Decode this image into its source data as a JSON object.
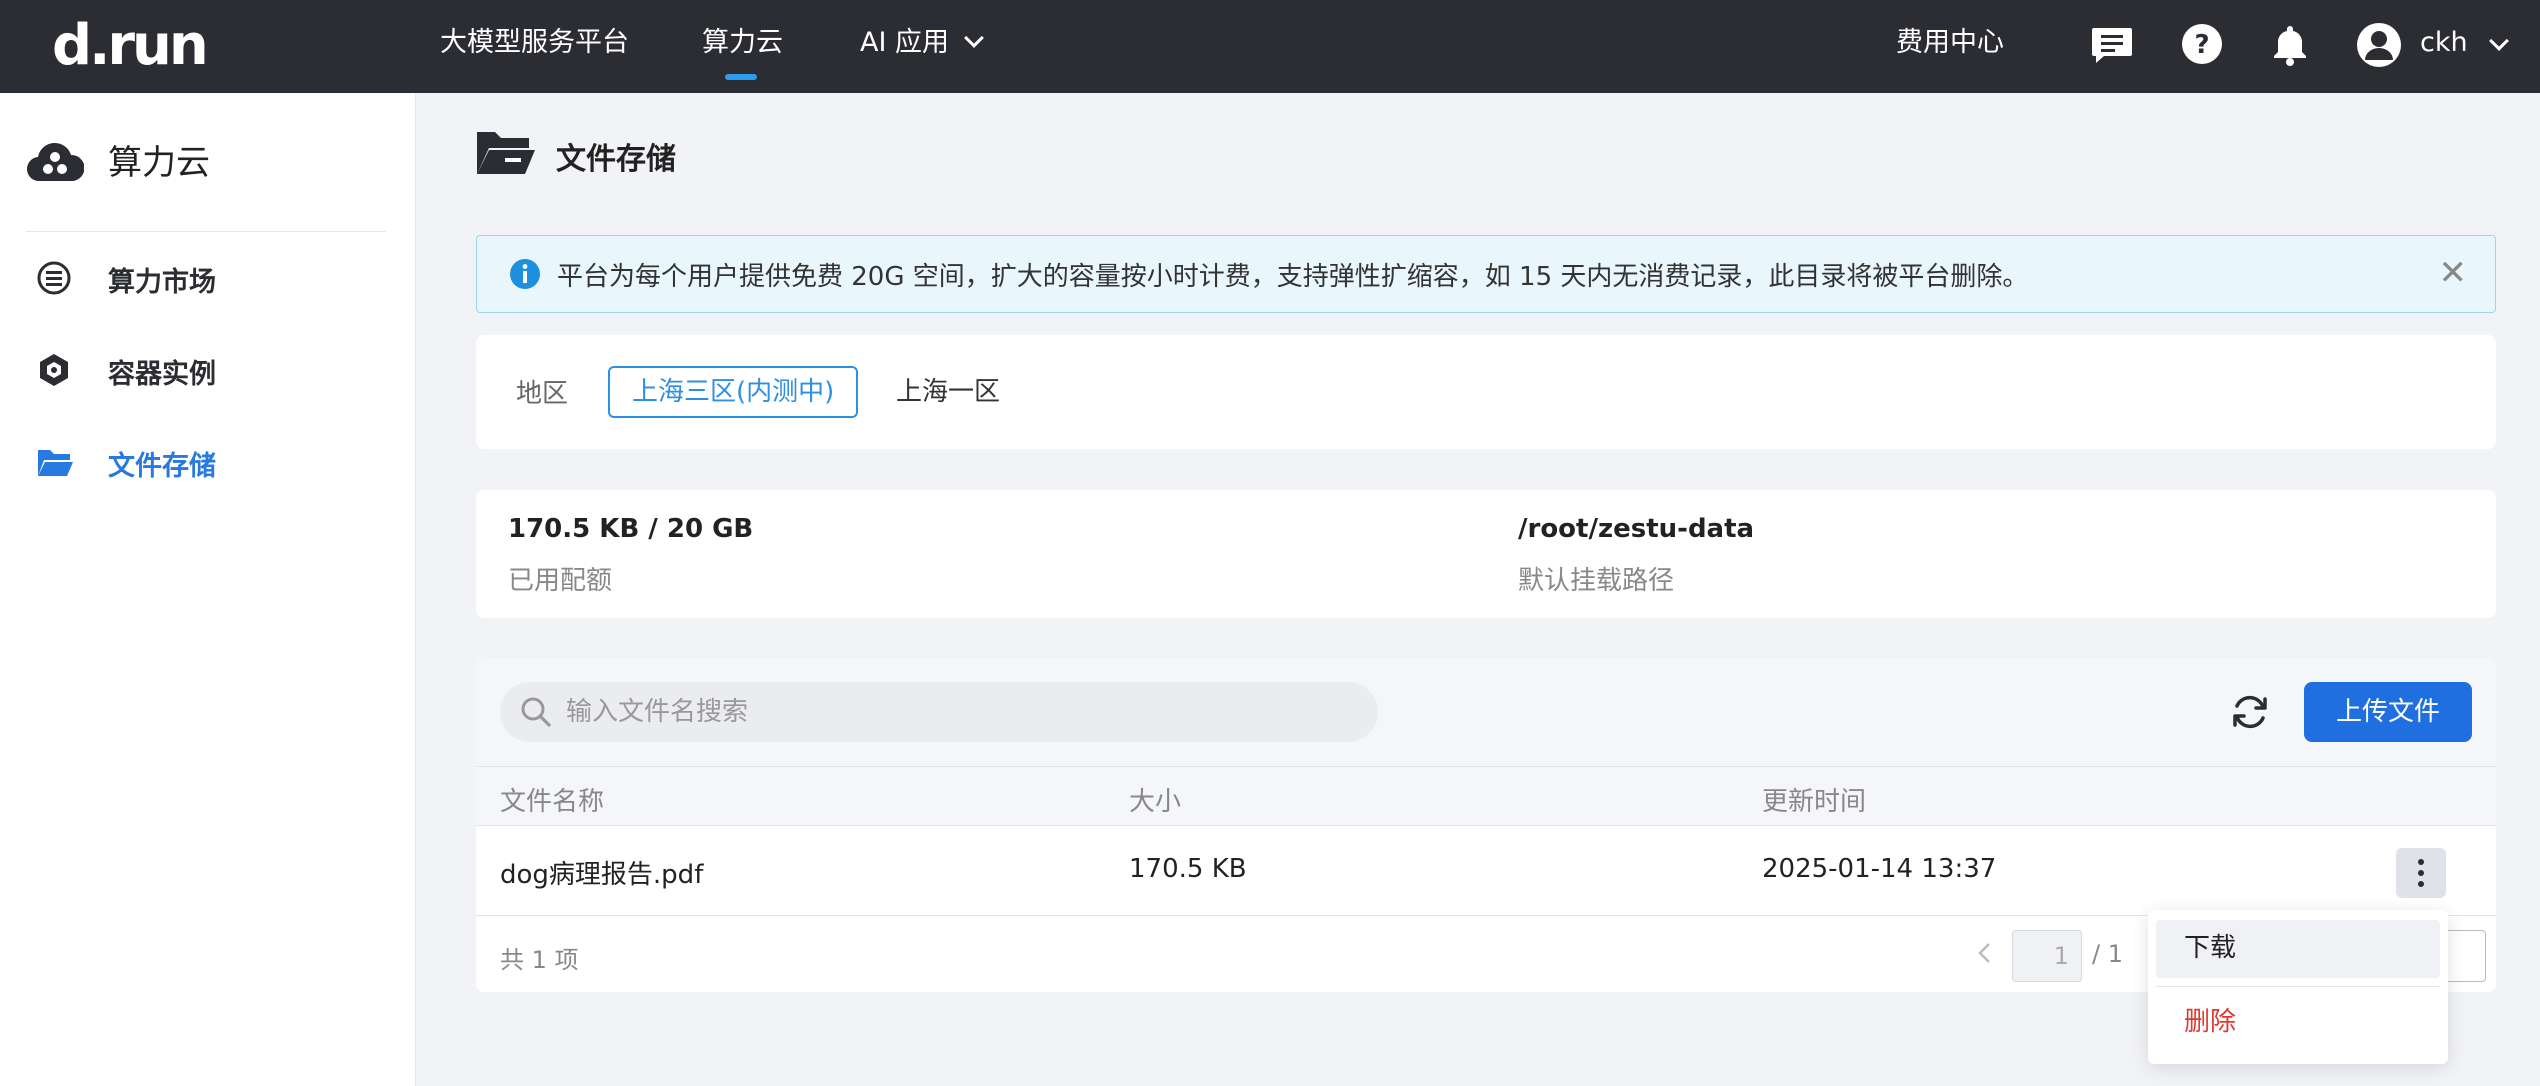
{
  "app": {
    "logo": "d.run"
  },
  "topnav": {
    "items": [
      {
        "label": "大模型服务平台"
      },
      {
        "label": "算力云"
      },
      {
        "label": "AI 应用"
      }
    ],
    "billing": "费用中心",
    "user": "ckh"
  },
  "sidebar": {
    "title": "算力云",
    "items": [
      {
        "label": "算力市场",
        "icon": "market-icon"
      },
      {
        "label": "容器实例",
        "icon": "container-icon"
      },
      {
        "label": "文件存储",
        "icon": "folder-icon"
      }
    ]
  },
  "main": {
    "title": "文件存储",
    "alert": "平台为每个用户提供免费 20G 空间，扩大的容量按小时计费，支持弹性扩缩容，如 15 天内无消费记录，此目录将被平台删除。",
    "region": {
      "label": "地区",
      "options": [
        "上海三区(内测中)",
        "上海一区"
      ]
    },
    "quota": {
      "used_value": "170.5 KB / 20 GB",
      "used_label": "已用配额",
      "path_value": "/root/zestu-data",
      "path_label": "默认挂载路径"
    },
    "search": {
      "placeholder": "输入文件名搜索"
    },
    "upload_label": "上传文件",
    "table": {
      "headers": [
        "文件名称",
        "大小",
        "更新时间"
      ],
      "rows": [
        {
          "name": "dog病理报告.pdf",
          "size": "170.5 KB",
          "updated": "2025-01-14 13:37"
        }
      ]
    },
    "footer": {
      "total": "共 1 项",
      "page": "1",
      "page_total": "/ 1"
    },
    "menu": {
      "download": "下载",
      "delete": "删除"
    }
  },
  "colors": {
    "topbar": "#2b2d33",
    "accent": "#1f6fe0",
    "active_nav": "#2879e0",
    "danger": "#e0382f",
    "alert_bg": "#e9f7fd"
  }
}
